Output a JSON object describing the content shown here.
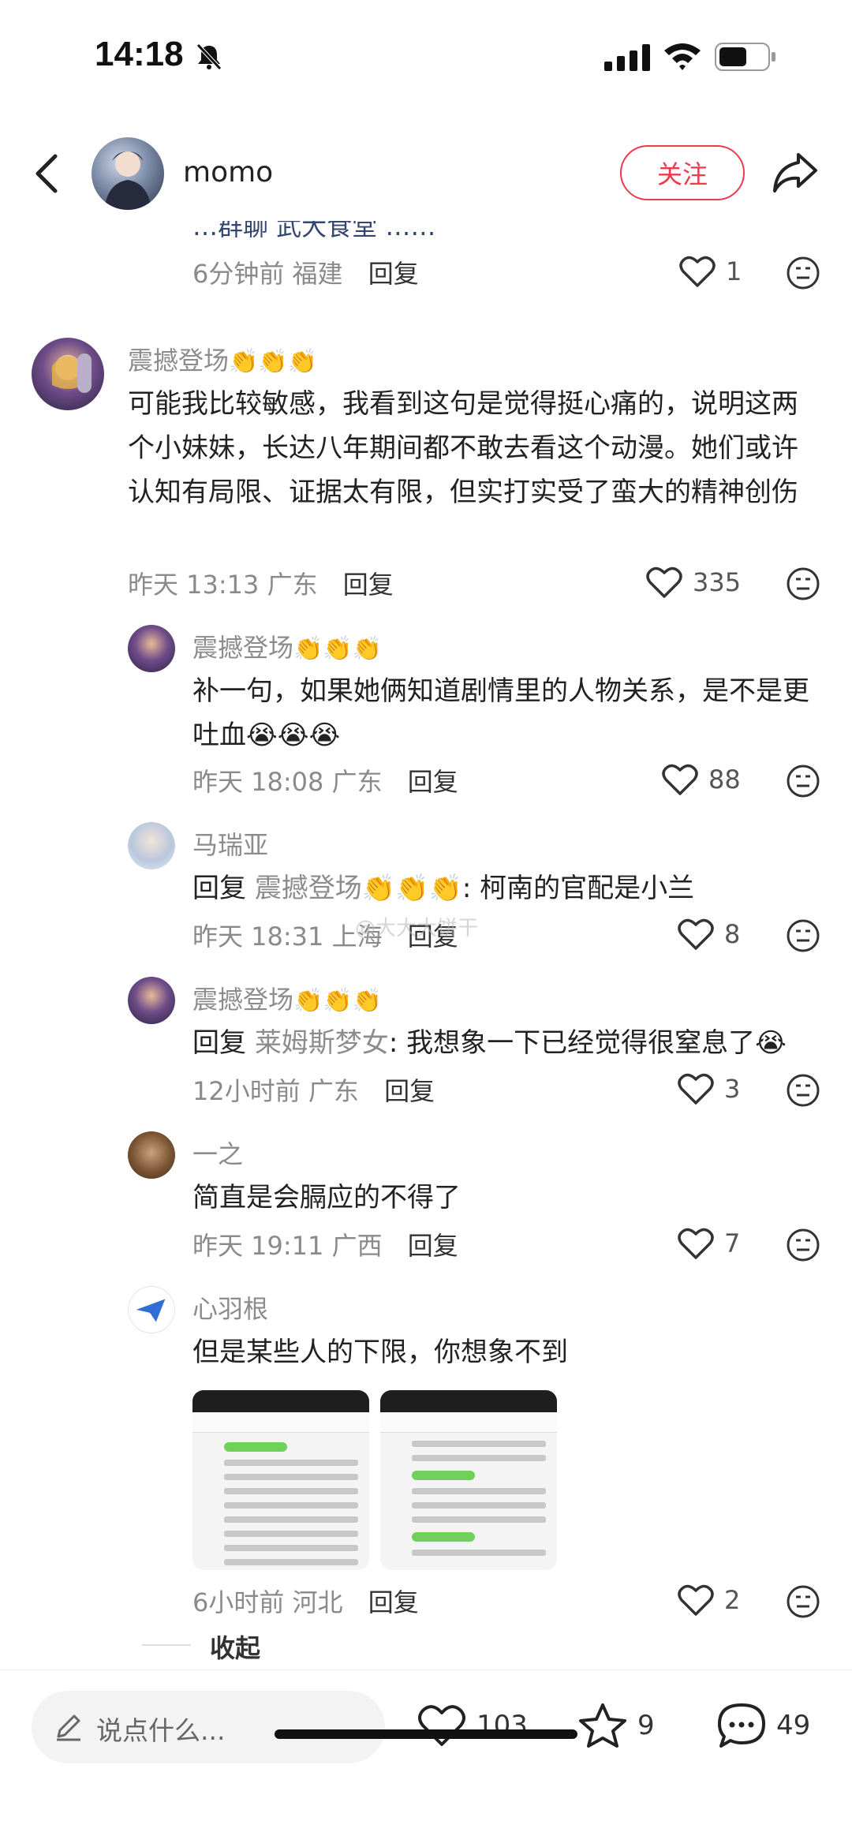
{
  "status": {
    "time": "14:18"
  },
  "header": {
    "username": "momo",
    "follow_label": "关注"
  },
  "top_comment": {
    "cut_text": "…群聊 武大食堂 ……",
    "time": "6分钟前",
    "location": "福建",
    "reply_label": "回复",
    "likes": "1"
  },
  "comments": [
    {
      "name": "震撼登场",
      "emoji": "👏👏👏",
      "text": "可能我比较敏感，我看到这句是觉得挺心痛的，说明这两个小妹妹，长达八年期间都不敢去看这个动漫。她们或许认知有局限、证据太有限，但实打实受了蛮大的精神创伤",
      "time": "昨天 13:13",
      "location": "广东",
      "reply_label": "回复",
      "likes": "335"
    }
  ],
  "replies": [
    {
      "name": "震撼登场",
      "emoji": "👏👏👏",
      "text": "补一句，如果她俩知道剧情里的人物关系，是不是更吐血😭😭😭",
      "time": "昨天 18:08",
      "location": "广东",
      "reply_label": "回复",
      "likes": "88"
    },
    {
      "name": "马瑞亚",
      "reply_prefix": "回复",
      "reply_to": "震撼登场👏👏👏",
      "text": ": 柯南的官配是小兰",
      "time": "昨天 18:31",
      "location": "上海",
      "reply_label": "回复",
      "likes": "8"
    },
    {
      "name": "震撼登场",
      "emoji": "👏👏👏",
      "reply_prefix": "回复",
      "reply_to": "莱姆斯梦女",
      "text": ": 我想象一下已经觉得很窒息了😭",
      "time": "12小时前",
      "location": "广东",
      "reply_label": "回复",
      "likes": "3"
    },
    {
      "name": "一之",
      "text": "简直是会膈应的不得了",
      "time": "昨天 19:11",
      "location": "广西",
      "reply_label": "回复",
      "likes": "7"
    },
    {
      "name": "心羽根",
      "text": "但是某些人的下限，你想象不到",
      "time": "6小时前",
      "location": "河北",
      "reply_label": "回复",
      "likes": "2"
    }
  ],
  "collapse_label": "收起",
  "watermark": "@大大大饼干",
  "bottom": {
    "placeholder": "说点什么...",
    "likes": "103",
    "stars": "9",
    "comments": "49"
  },
  "colors": {
    "accent": "#ef3a4d",
    "meta": "#8a8a8a"
  }
}
